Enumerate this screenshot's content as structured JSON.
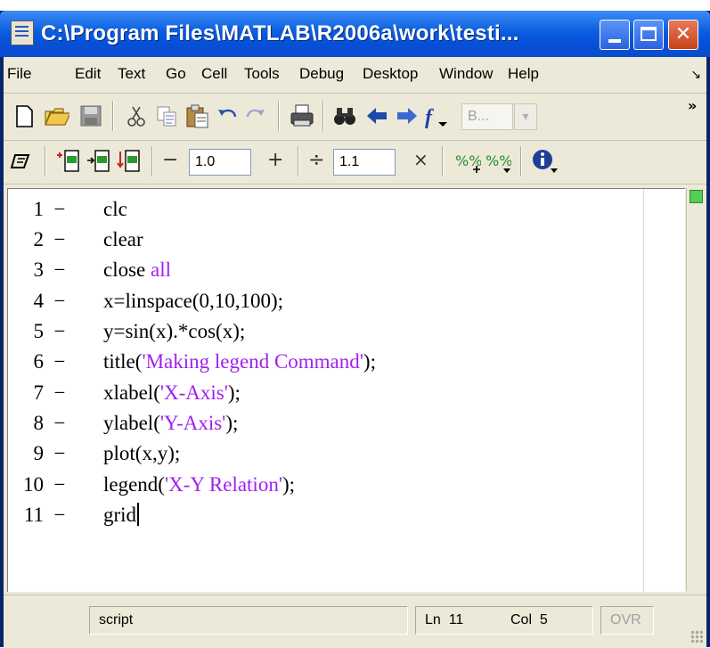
{
  "window": {
    "title": "C:\\Program Files\\MATLAB\\R2006a\\work\\testi...",
    "minimize_glyph": "",
    "maximize_glyph": "",
    "close_glyph": "✕"
  },
  "menu": {
    "items": [
      "File",
      "Edit",
      "Text",
      "Go",
      "Cell",
      "Tools",
      "Debug",
      "Desktop",
      "Window",
      "Help"
    ],
    "overflow_glyph": "↘"
  },
  "toolbar": {
    "stack_field": "B...",
    "overflow": "»"
  },
  "cell_toolbar": {
    "decrement_label": "−",
    "value_1": "1.0",
    "increment_label": "+",
    "divide_label": "÷",
    "value_2": "1.1",
    "multiply_label": "×"
  },
  "editor": {
    "lines": [
      {
        "num": "1",
        "dash": "−",
        "code": "clc",
        "str": ""
      },
      {
        "num": "2",
        "dash": "−",
        "code": "clear",
        "str": ""
      },
      {
        "num": "3",
        "dash": "−",
        "code": "close ",
        "str": "all"
      },
      {
        "num": "4",
        "dash": "−",
        "code": "x=linspace(0,10,100);",
        "str": ""
      },
      {
        "num": "5",
        "dash": "−",
        "code": "y=sin(x).*cos(x);",
        "str": ""
      },
      {
        "num": "6",
        "dash": "−",
        "code": "title(",
        "str": "'Making legend Command'",
        "tail": ");"
      },
      {
        "num": "7",
        "dash": "−",
        "code": "xlabel(",
        "str": "'X-Axis'",
        "tail": ");"
      },
      {
        "num": "8",
        "dash": "−",
        "code": "ylabel(",
        "str": "'Y-Axis'",
        "tail": ");"
      },
      {
        "num": "9",
        "dash": "−",
        "code": "plot(x,y);",
        "str": ""
      },
      {
        "num": "10",
        "dash": "−",
        "code": "legend(",
        "str": "'X-Y Relation'",
        "tail": ");"
      },
      {
        "num": "11",
        "dash": "−",
        "code": "grid",
        "str": ""
      }
    ]
  },
  "status": {
    "mode": "script",
    "ln_label": "Ln",
    "ln_value": "11",
    "col_label": "Col",
    "col_value": "5",
    "ovr": "OVR"
  },
  "colors": {
    "title_bar": "#0a5ee0",
    "string_purple": "#a020f0",
    "chrome": "#ece9d8"
  }
}
